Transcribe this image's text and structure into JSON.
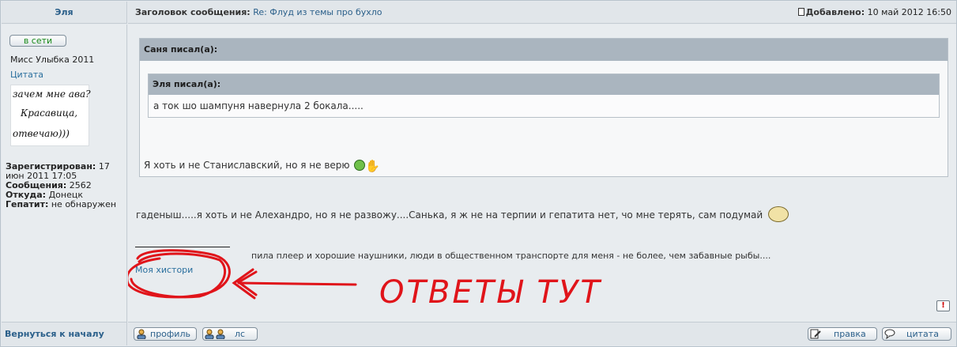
{
  "header": {
    "author": "Эля",
    "subject_label": "Заголовок сообщения:",
    "subject": "Re: Флуд из темы про бухло",
    "added_label": "Добавлено:",
    "added_date": "10 май 2012 16:50"
  },
  "user": {
    "online_label": "в сети",
    "rank": "Мисс Улыбка 2011",
    "quote_link": "Цитата",
    "avatar_lines": [
      "зачем мне ава?",
      "Красавица,",
      "отвечаю)))"
    ],
    "registered_label": "Зарегистрирован:",
    "registered_value": "17 июн 2011 17:05",
    "posts_label": "Сообщения:",
    "posts_value": "2562",
    "from_label": "Откуда:",
    "from_value": "Донецк",
    "hepatitis_label": "Гепатит:",
    "hepatitis_value": "не обнаружен"
  },
  "post": {
    "outer_quote_author": "Саня писал(а):",
    "inner_quote_author": "Эля писал(а):",
    "inner_quote_text": "а ток шо шампуня навернула 2 бокала.....",
    "outer_quote_text": "Я хоть и не Станиславский, но я не верю",
    "body_text": "гаденыш.....я хоть и не Алехандро, но я не развожу....Санька, я ж не на терпии и гепатита нет, чо мне терять, сам подумай",
    "signature_text": "пила плеер и хорошие наушники, люди в общественном транспорте для меня - не более, чем забавные рыбы....",
    "signature_link": "Моя хистори",
    "annotation_text": "ОТВЕТЫ   ТУТ"
  },
  "footer": {
    "back_to_top": "Вернуться к началу",
    "profile_btn": "профиль",
    "pm_btn": "лс",
    "edit_btn": "правка",
    "quote_btn": "цитата"
  },
  "colors": {
    "annotation": "#e0141a",
    "link": "#2a6f9e",
    "online": "#198a19"
  }
}
